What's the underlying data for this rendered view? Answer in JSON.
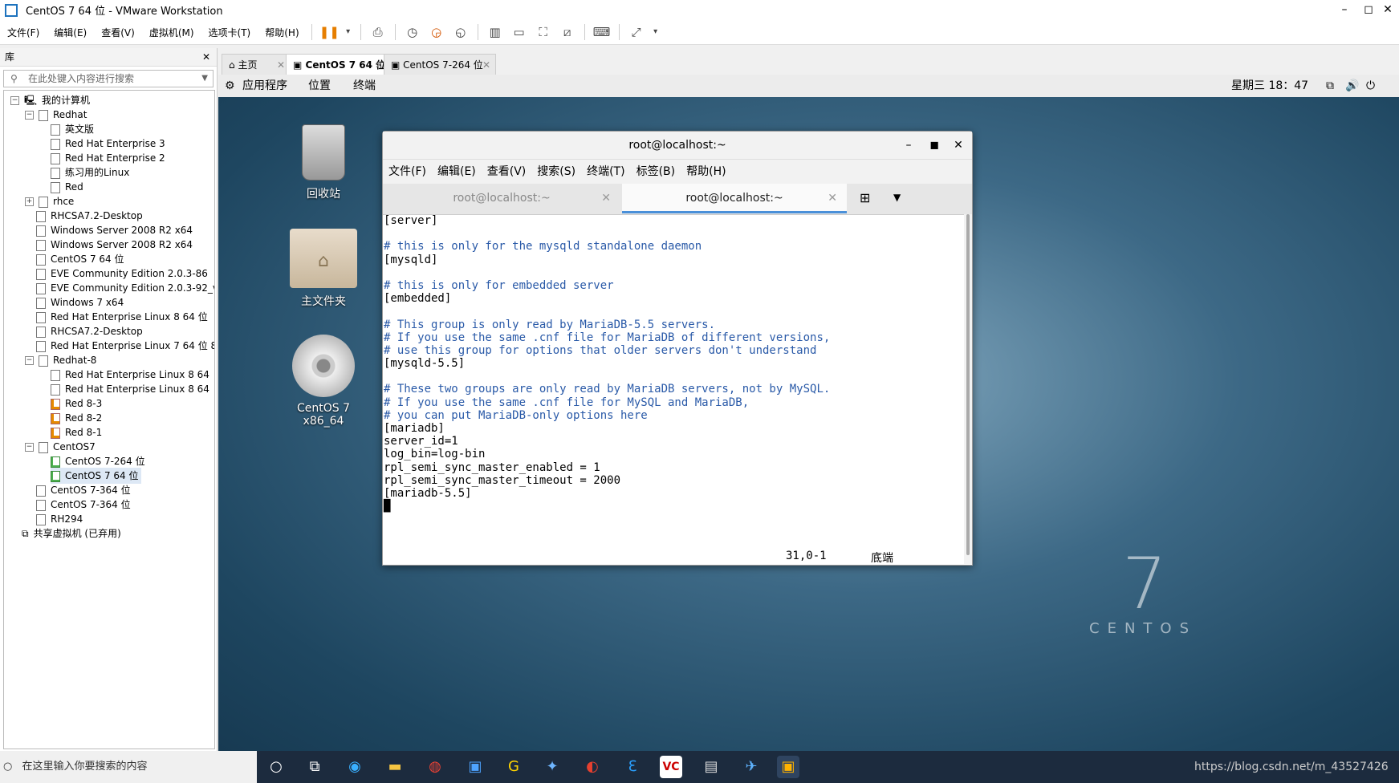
{
  "window": {
    "title": "CentOS 7 64 位 - VMware Workstation",
    "minimize": "–",
    "maximize": "◻",
    "close": "✕"
  },
  "menubar": {
    "items": [
      "文件(F)",
      "编辑(E)",
      "查看(V)",
      "虚拟机(M)",
      "选项卡(T)",
      "帮助(H)"
    ]
  },
  "library": {
    "title": "库",
    "close": "✕",
    "search_placeholder": "在此处键入内容进行搜索",
    "tree": [
      {
        "label": "我的计算机",
        "expander": "−"
      },
      {
        "label": "Redhat",
        "expander": "−"
      },
      {
        "label": "英文版"
      },
      {
        "label": "Red Hat Enterprise 3"
      },
      {
        "label": "Red Hat Enterprise 2"
      },
      {
        "label": "练习用的Linux"
      },
      {
        "label": "Red"
      },
      {
        "label": "rhce",
        "expander": "+"
      },
      {
        "label": "RHCSA7.2-Desktop"
      },
      {
        "label": "Windows Server 2008 R2 x64"
      },
      {
        "label": "Windows Server 2008 R2 x64"
      },
      {
        "label": "CentOS 7 64 位"
      },
      {
        "label": "EVE Community Edition 2.0.3-86"
      },
      {
        "label": "EVE Community Edition 2.0.3-92_v"
      },
      {
        "label": "Windows 7 x64"
      },
      {
        "label": "Red Hat Enterprise Linux 8 64 位"
      },
      {
        "label": "RHCSA7.2-Desktop"
      },
      {
        "label": "Red Hat Enterprise Linux 7 64 位 8"
      },
      {
        "label": "Redhat-8",
        "expander": "−"
      },
      {
        "label": "Red Hat Enterprise Linux 8 64"
      },
      {
        "label": "Red Hat Enterprise Linux 8 64"
      },
      {
        "label": "Red 8-3"
      },
      {
        "label": "Red 8-2"
      },
      {
        "label": "Red 8-1"
      },
      {
        "label": "CentOS7",
        "expander": "−"
      },
      {
        "label": "CentOS 7-264 位"
      },
      {
        "label": "CentOS 7 64 位"
      },
      {
        "label": "CentOS 7-364 位"
      },
      {
        "label": "CentOS 7-364 位"
      },
      {
        "label": "RH294"
      },
      {
        "label": "共享虚拟机 (已弃用)"
      }
    ]
  },
  "tabs": [
    {
      "label": "主页",
      "close": "✕"
    },
    {
      "label": "CentOS 7 64 位",
      "close": "✕"
    },
    {
      "label": "CentOS 7-264 位",
      "close": "✕"
    }
  ],
  "gnome": {
    "applications": "应用程序",
    "places": "位置",
    "terminal": "终端",
    "clock": "星期三 18：47"
  },
  "desktop": {
    "trash": "回收站",
    "home": "主文件夹",
    "disc": "CentOS 7 x86_64",
    "brand_number": "7",
    "brand_text": "CENTOS"
  },
  "terminal": {
    "title": "root@localhost:~",
    "menu": [
      "文件(F)",
      "编辑(E)",
      "查看(V)",
      "搜索(S)",
      "终端(T)",
      "标签(B)",
      "帮助(H)"
    ],
    "tabs": [
      {
        "label": "root@localhost:~"
      },
      {
        "label": "root@localhost:~"
      }
    ],
    "lines": [
      {
        "text": "[server]",
        "comment": false
      },
      {
        "text": "",
        "comment": false
      },
      {
        "text": "# this is only for the mysqld standalone daemon",
        "comment": true
      },
      {
        "text": "[mysqld]",
        "comment": false
      },
      {
        "text": "",
        "comment": false
      },
      {
        "text": "# this is only for embedded server",
        "comment": true
      },
      {
        "text": "[embedded]",
        "comment": false
      },
      {
        "text": "",
        "comment": false
      },
      {
        "text": "# This group is only read by MariaDB-5.5 servers.",
        "comment": true
      },
      {
        "text": "# If you use the same .cnf file for MariaDB of different versions,",
        "comment": true
      },
      {
        "text": "# use this group for options that older servers don't understand",
        "comment": true
      },
      {
        "text": "[mysqld-5.5]",
        "comment": false
      },
      {
        "text": "",
        "comment": false
      },
      {
        "text": "# These two groups are only read by MariaDB servers, not by MySQL.",
        "comment": true
      },
      {
        "text": "# If you use the same .cnf file for MySQL and MariaDB,",
        "comment": true
      },
      {
        "text": "# you can put MariaDB-only options here",
        "comment": true
      },
      {
        "text": "[mariadb]",
        "comment": false
      },
      {
        "text": "server_id=1",
        "comment": false
      },
      {
        "text": "log_bin=log-bin",
        "comment": false
      },
      {
        "text": "rpl_semi_sync_master_enabled = 1",
        "comment": false
      },
      {
        "text": "rpl_semi_sync_master_timeout = 2000",
        "comment": false
      },
      {
        "text": "[mariadb-5.5]",
        "comment": false
      },
      {
        "text": "█",
        "comment": false
      }
    ],
    "status_pos": "31,0-1",
    "status_where": "底端"
  },
  "taskbar": {
    "search_placeholder": "在这里输入你要搜索的内容",
    "tray_text": "https://blog.csdn.net/m_43527426"
  },
  "colors": {
    "accent": "#4a90d9",
    "comment": "#2a5aa8",
    "taskbar": "#1c2b3e"
  }
}
